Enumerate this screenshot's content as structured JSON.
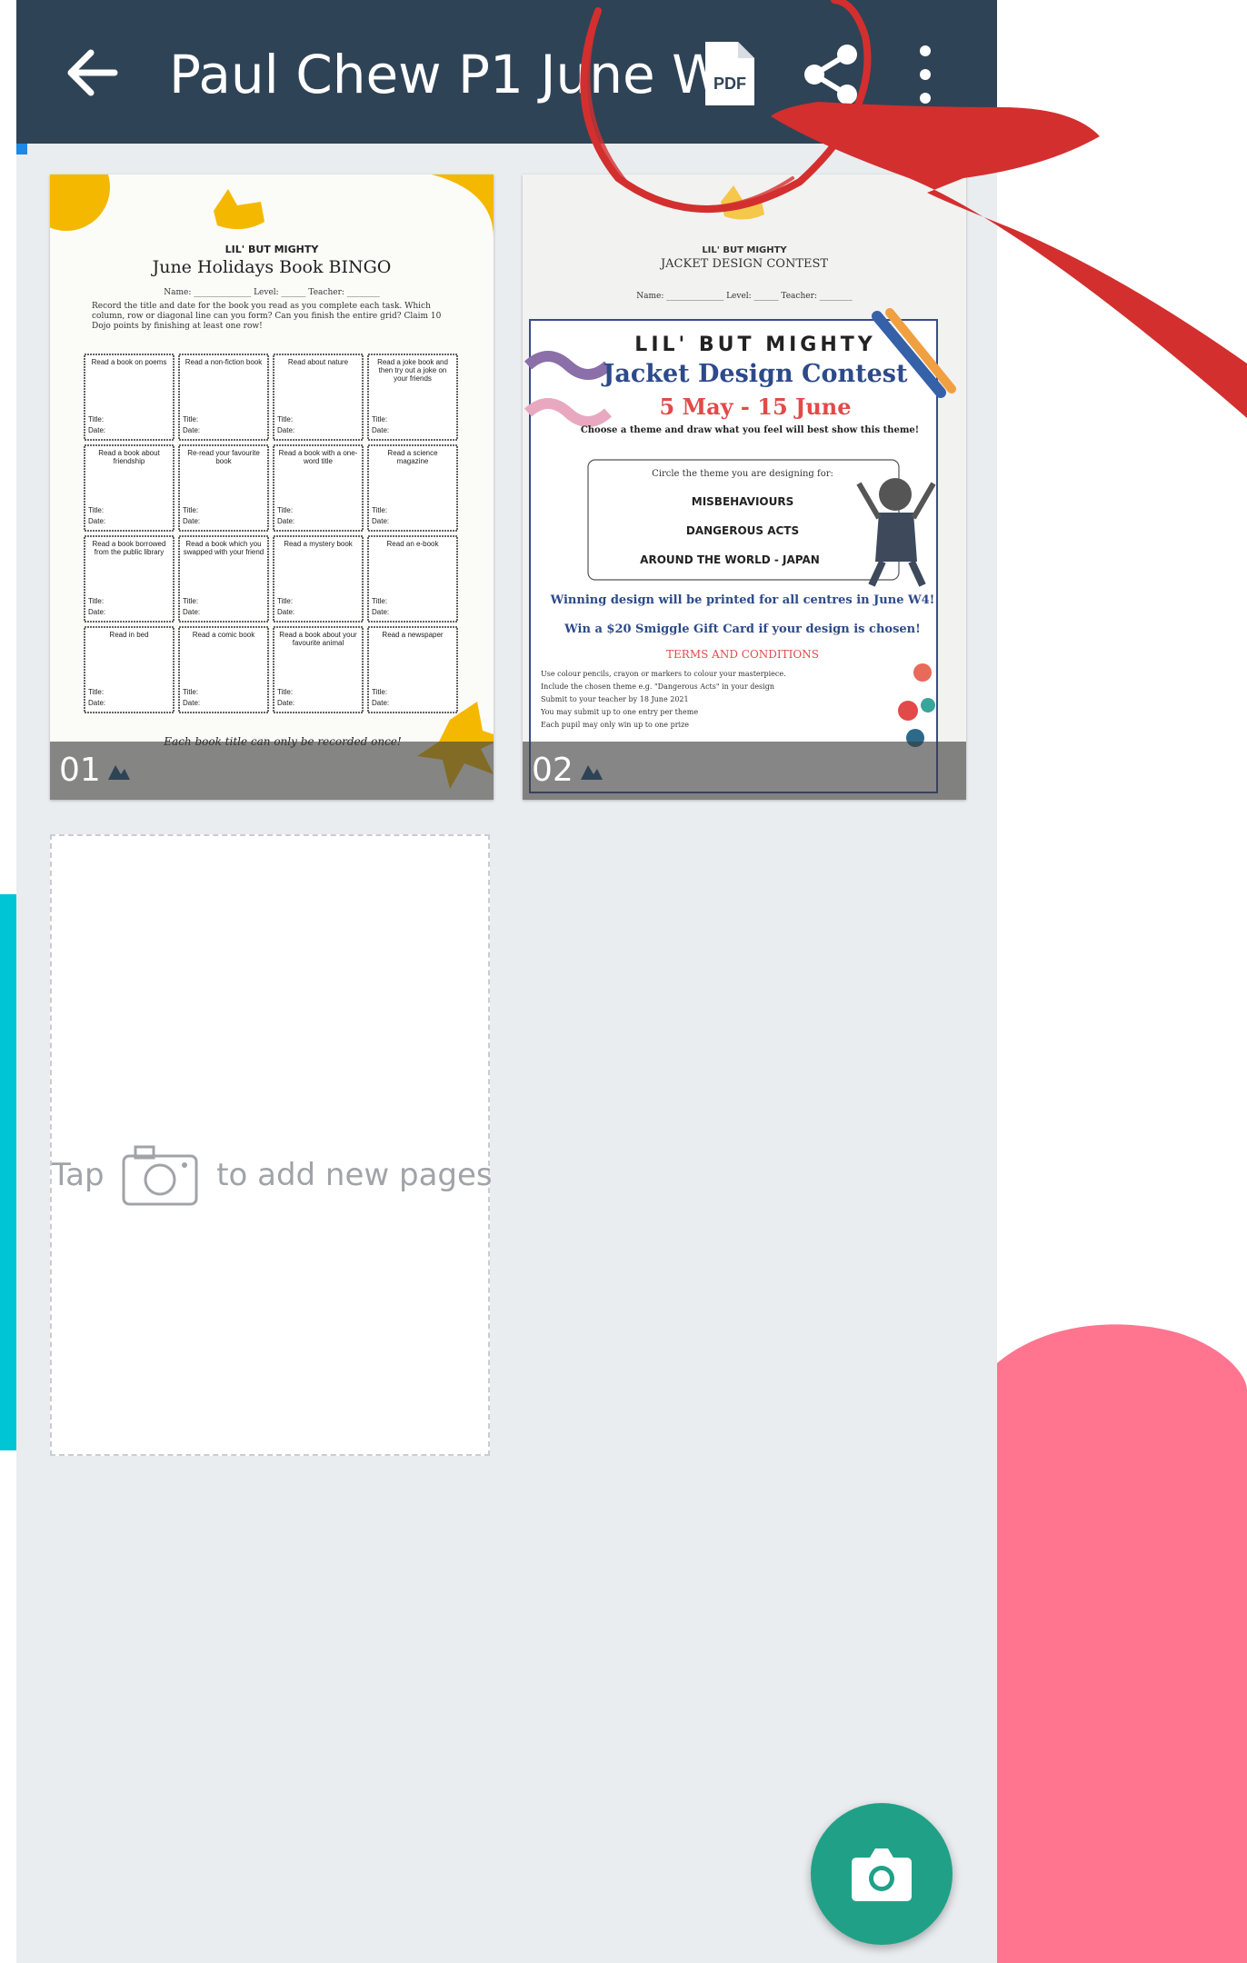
{
  "appbar": {
    "title": "Paul Chew P1 June W1",
    "back_icon": "arrow-left-icon",
    "pdf_icon": "pdf-file-icon",
    "pdf_label": "PDF",
    "share_icon": "share-icon",
    "more_icon": "more-vertical-icon"
  },
  "pages": [
    {
      "number": "01",
      "brand": "LIL' BUT MIGHTY",
      "title": "June Holidays Book BINGO",
      "name_line": "Name: ______________  Level: ______  Teacher: ________",
      "instructions": "Record the title and date for the book you read as you complete each task. Which column, row or diagonal line can you form? Can you finish the entire grid? Claim 10 Dojo points by finishing at least one row!",
      "tasks": [
        "Read a book on poems",
        "Read a non-fiction book",
        "Read about nature",
        "Read a joke book and then try out a joke on your friends",
        "Read a book about friendship",
        "Re-read your favourite book",
        "Read a book with a one-word title",
        "Read a science magazine",
        "Read a book borrowed from the public library",
        "Read a book which you swapped with your friend",
        "Read a mystery book",
        "Read an e-book",
        "Read in bed",
        "Read a comic book",
        "Read a book about your favourite animal",
        "Read a newspaper"
      ],
      "cell_title_label": "Title:",
      "cell_date_label": "Date:",
      "footer_note": "Each book title can only be recorded once!"
    },
    {
      "number": "02",
      "brand": "LIL' BUT MIGHTY",
      "subtitle": "JACKET DESIGN CONTEST",
      "name_line": "Name: ______________  Level: ______  Teacher: ________",
      "poster_brand": "LIL' BUT MIGHTY",
      "poster_title": "Jacket Design Contest",
      "dates": "5 May - 15 June",
      "choose_text": "Choose a theme and draw what you feel will best show this theme!",
      "circle_text": "Circle the theme you are designing for:",
      "themes": [
        "MISBEHAVIOURS",
        "DANGEROUS ACTS",
        "AROUND THE WORLD - JAPAN"
      ],
      "winning_text": "Winning design will be printed for all centres in June W4!",
      "prize_text": "Win a $20 Smiggle Gift Card if your design is chosen!",
      "terms_heading": "TERMS AND CONDITIONS",
      "terms": [
        "Use colour pencils, crayon or markers to colour your masterpiece.",
        "Include the chosen theme e.g. \"Dangerous Acts\" in your design",
        "Submit to your teacher by 18 June 2021",
        "You may submit up to one entry per theme",
        "Each pupil may only win up to one prize"
      ]
    }
  ],
  "add_page": {
    "hint_before": "Tap",
    "hint_after": "to add new pages",
    "icon": "camera-outline-icon"
  },
  "fab": {
    "icon": "camera-icon"
  },
  "colors": {
    "appbar": "#2f4356",
    "background": "#eaedf0",
    "fab": "#20a187",
    "annotation_red": "#d32f2f",
    "deco_pink": "#ff7590",
    "deco_cyan": "#00c5d4"
  }
}
